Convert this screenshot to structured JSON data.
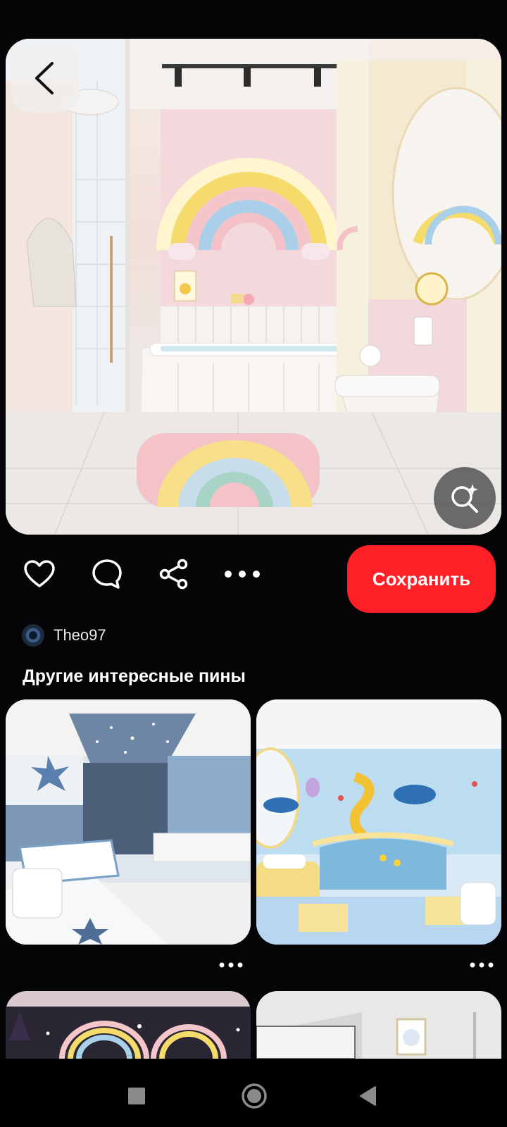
{
  "pin": {
    "image_alt": "Pastel kids bathroom with rainbow",
    "author": "Theo97",
    "save_label": "Сохранить"
  },
  "section": {
    "title": "Другие интересные пины"
  },
  "grid": [
    {
      "alt": "Star-themed blue bathroom"
    },
    {
      "alt": "Ocean-themed bathroom with whales and slide"
    },
    {
      "alt": "Rainbow wall bathroom"
    },
    {
      "alt": "White bathroom with bunny picture"
    }
  ],
  "colors": {
    "background": "#050407",
    "save": "#ff1f26"
  },
  "icons": {
    "back": "chevron-left-icon",
    "lens": "visual-search-icon",
    "like": "heart-icon",
    "comment": "comment-icon",
    "share": "share-icon",
    "more": "more-horizontal-icon",
    "nav_recents": "square-icon",
    "nav_home": "circle-icon",
    "nav_back": "triangle-back-icon"
  }
}
